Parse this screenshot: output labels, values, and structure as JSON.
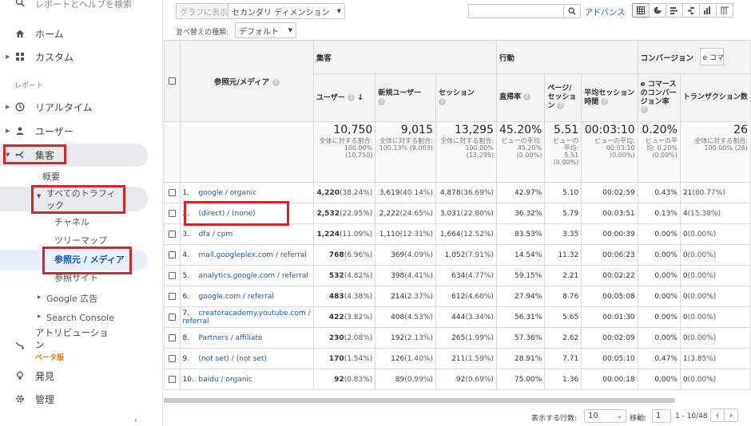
{
  "sidebar": {
    "search_label": "レポートとヘルプを検索",
    "home": "ホーム",
    "custom": "カスタム",
    "reports_header": "レポート",
    "realtime": "リアルタイム",
    "users": "ユーザー",
    "acquisition": "集客",
    "overview": "概要",
    "all_traffic": "すべてのトラフィック",
    "channels": "チャネル",
    "treemap": "ツリーマップ",
    "source_medium": "参照元 / メディア",
    "referrals": "参照サイト",
    "google_ads": "Google 広告",
    "search_console": "Search Console",
    "attribution": "アトリビューション",
    "beta": "ベータ版",
    "discover": "発見",
    "admin": "管理"
  },
  "toolbar": {
    "plot_rows": "グラフに表示",
    "secondary_dimension": "セカンダリ ディメンション",
    "advanced": "アドバンス",
    "sort_type_label": "並べ替えの種類:",
    "sort_type_value": "デフォルト"
  },
  "table": {
    "dimension_header": "参照元/メディア",
    "groups": {
      "acquisition": "集客",
      "behavior": "行動",
      "conversions": "コンバージョン",
      "ecommerce_select": "e コマース"
    },
    "metrics": [
      "ユーザー",
      "新規ユーザー",
      "セッション",
      "直帰率",
      "ページ/セッション",
      "平均セッション時間",
      "e コマースのコンバージョン率",
      "トランザクション数"
    ],
    "totals": [
      {
        "value": "10,750",
        "sub": "全体に対する割合: 100.00% (10,750)"
      },
      {
        "value": "9,015",
        "sub": "全体に対する割合: 100.13% (9,003)"
      },
      {
        "value": "13,295",
        "sub": "全体に対する割合: 100.00% (13,295)"
      },
      {
        "value": "45.20%",
        "sub": "ビューの平均: 45.20% (0.00%)"
      },
      {
        "value": "5.51",
        "sub": "ビューの平均: 5.51 (0.00%)"
      },
      {
        "value": "00:03:10",
        "sub": "ビューの平均: 00:03:10 (0.00%)"
      },
      {
        "value": "0.20%",
        "sub": "ビューの平均: 0.20% (0.00%)"
      },
      {
        "value": "26",
        "sub": "全体に対する割合: 100.00% (26)"
      }
    ],
    "rows": [
      {
        "num": "1.",
        "dim": "google / organic",
        "users": "4,220",
        "users_pct": "(38.24%)",
        "new": "3,619",
        "new_pct": "(40.14%)",
        "sess": "4,878",
        "sess_pct": "(36.69%)",
        "bounce": "42.97%",
        "pps": "5.10",
        "dur": "00:02:59",
        "conv": "0.43%",
        "tx": "21",
        "tx_pct": "(80.77%)"
      },
      {
        "num": "2.",
        "dim": "(direct) / (none)",
        "users": "2,532",
        "users_pct": "(22.95%)",
        "new": "2,222",
        "new_pct": "(24.65%)",
        "sess": "3,031",
        "sess_pct": "(22.80%)",
        "bounce": "36.32%",
        "pps": "5.79",
        "dur": "00:03:51",
        "conv": "0.13%",
        "tx": "4",
        "tx_pct": "(15.38%)"
      },
      {
        "num": "3.",
        "dim": "dfa / cpm",
        "users": "1,224",
        "users_pct": "(11.09%)",
        "new": "1,110",
        "new_pct": "(12.31%)",
        "sess": "1,664",
        "sess_pct": "(12.52%)",
        "bounce": "83.53%",
        "pps": "3.35",
        "dur": "00:00:39",
        "conv": "0.00%",
        "tx": "0",
        "tx_pct": "(0.00%)"
      },
      {
        "num": "4.",
        "dim": "mall.googleplex.com / referral",
        "users": "768",
        "users_pct": "(6.96%)",
        "new": "369",
        "new_pct": "(4.09%)",
        "sess": "1,052",
        "sess_pct": "(7.91%)",
        "bounce": "14.54%",
        "pps": "11.32",
        "dur": "00:06:23",
        "conv": "0.00%",
        "tx": "0",
        "tx_pct": "(0.00%)"
      },
      {
        "num": "5.",
        "dim": "analytics.google.com / referral",
        "users": "532",
        "users_pct": "(4.82%)",
        "new": "398",
        "new_pct": "(4.41%)",
        "sess": "634",
        "sess_pct": "(4.77%)",
        "bounce": "59.15%",
        "pps": "2.21",
        "dur": "00:02:22",
        "conv": "0.00%",
        "tx": "0",
        "tx_pct": "(0.00%)"
      },
      {
        "num": "6.",
        "dim": "google.com / referral",
        "users": "483",
        "users_pct": "(4.38%)",
        "new": "214",
        "new_pct": "(2.37%)",
        "sess": "612",
        "sess_pct": "(4.60%)",
        "bounce": "27.94%",
        "pps": "8.76",
        "dur": "00:05:08",
        "conv": "0.00%",
        "tx": "0",
        "tx_pct": "(0.00%)"
      },
      {
        "num": "7.",
        "dim": "creatoracademy.youtube.com / referral",
        "users": "422",
        "users_pct": "(3.82%)",
        "new": "408",
        "new_pct": "(4.53%)",
        "sess": "444",
        "sess_pct": "(3.34%)",
        "bounce": "56.31%",
        "pps": "5.65",
        "dur": "00:01:30",
        "conv": "0.00%",
        "tx": "0",
        "tx_pct": "(0.00%)"
      },
      {
        "num": "8.",
        "dim": "Partners / affiliate",
        "users": "230",
        "users_pct": "(2.08%)",
        "new": "192",
        "new_pct": "(2.13%)",
        "sess": "265",
        "sess_pct": "(1.99%)",
        "bounce": "57.36%",
        "pps": "2.62",
        "dur": "00:02:09",
        "conv": "0.00%",
        "tx": "0",
        "tx_pct": "(0.00%)"
      },
      {
        "num": "9.",
        "dim": "(not set) / (not set)",
        "users": "170",
        "users_pct": "(1.54%)",
        "new": "126",
        "new_pct": "(1.40%)",
        "sess": "211",
        "sess_pct": "(1.59%)",
        "bounce": "28.91%",
        "pps": "7.71",
        "dur": "00:05:10",
        "conv": "0.47%",
        "tx": "1",
        "tx_pct": "(3.85%)"
      },
      {
        "num": "10.",
        "dim": "baidu / organic",
        "users": "92",
        "users_pct": "(0.83%)",
        "new": "89",
        "new_pct": "(0.99%)",
        "sess": "92",
        "sess_pct": "(0.69%)",
        "bounce": "75.00%",
        "pps": "1.36",
        "dur": "00:00:18",
        "conv": "0.00%",
        "tx": "0",
        "tx_pct": "(0.00%)"
      }
    ]
  },
  "pagination": {
    "rows_label": "表示する行数:",
    "rows_value": "10",
    "goto_label": "移動:",
    "goto_value": "1",
    "range": "1 - 10/48"
  },
  "colors": {
    "highlight": "#d8232a",
    "link": "#1a57b7"
  }
}
